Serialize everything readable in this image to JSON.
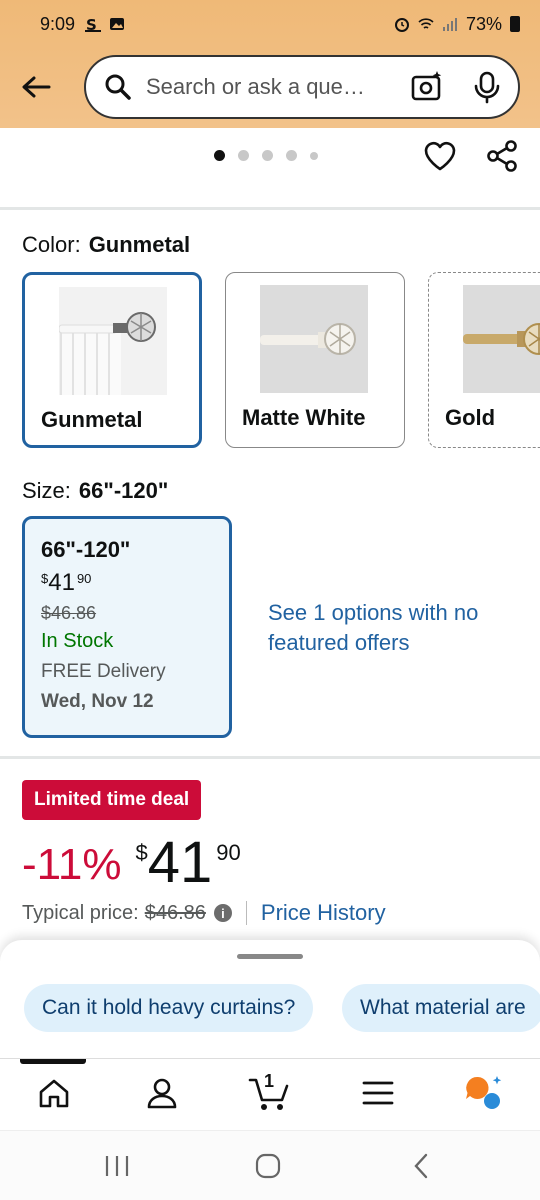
{
  "status_bar": {
    "time": "9:09",
    "battery": "73%"
  },
  "header": {
    "search_placeholder": "Search or ask a que…"
  },
  "gallery": {
    "dot_count": 5,
    "active_dot": 0
  },
  "color": {
    "label": "Color:",
    "selected": "Gunmetal",
    "options": [
      {
        "name": "Gunmetal"
      },
      {
        "name": "Matte White"
      },
      {
        "name": "Gold"
      }
    ]
  },
  "size": {
    "label": "Size:",
    "selected": "66\"-120\"",
    "card": {
      "name": "66\"-120\"",
      "price_symbol": "$",
      "price_whole": "41",
      "price_cents": "90",
      "list_price": "$46.86",
      "stock": "In Stock",
      "delivery": "FREE Delivery",
      "date": "Wed, Nov 12"
    },
    "see_options": "See 1 options with no featured offers"
  },
  "deal": {
    "badge": "Limited time deal",
    "discount": "-11%",
    "price_symbol": "$",
    "price_whole": "41",
    "price_cents": "90",
    "typical_label": "Typical price:",
    "typical_price": "$46.86",
    "price_history": "Price History"
  },
  "suggestions": [
    "Can it hold heavy curtains?",
    "What material are"
  ],
  "nav": {
    "cart_count": "1"
  },
  "colors": {
    "header_bg": "#efb977",
    "accent_blue": "#2162a1",
    "deal_red": "#cc0c39",
    "in_stock_green": "#007600"
  }
}
